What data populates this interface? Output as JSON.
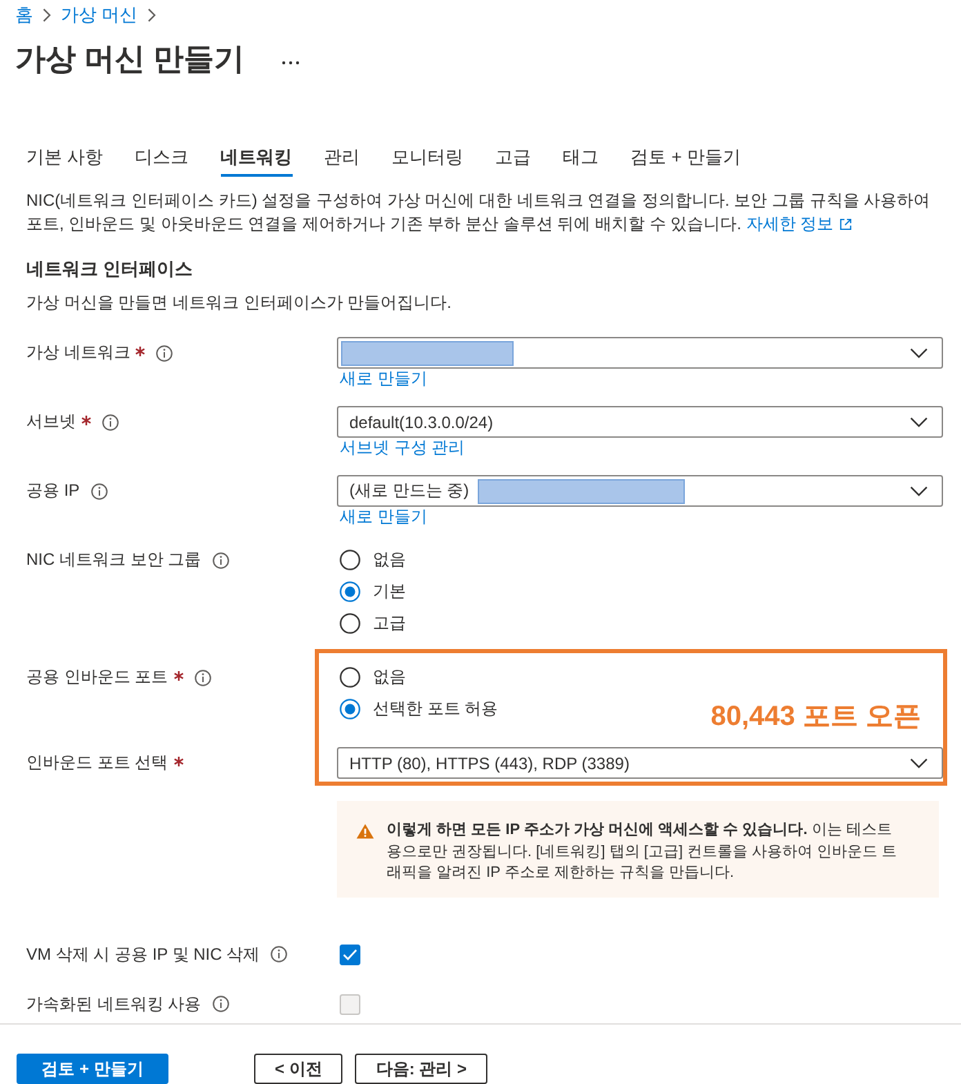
{
  "breadcrumb": [
    {
      "label": "홈"
    },
    {
      "label": "가상 머신"
    }
  ],
  "header": {
    "title": "가상 머신 만들기"
  },
  "tabs": [
    {
      "label": "기본 사항",
      "selected": false
    },
    {
      "label": "디스크",
      "selected": false
    },
    {
      "label": "네트워킹",
      "selected": true
    },
    {
      "label": "관리",
      "selected": false
    },
    {
      "label": "모니터링",
      "selected": false
    },
    {
      "label": "고급",
      "selected": false
    },
    {
      "label": "태그",
      "selected": false
    },
    {
      "label": "검토 + 만들기",
      "selected": false
    }
  ],
  "intro": {
    "text": "NIC(네트워크 인터페이스 카드) 설정을 구성하여 가상 머신에 대한 네트워크 연결을 정의합니다. 보안 그룹 규칙을 사용하여 포트, 인바운드 및 아웃바운드 연결을 제어하거나 기존 부하 분산 솔루션 뒤에 배치할 수 있습니다.",
    "link": "자세한 정보"
  },
  "section": {
    "title": "네트워크 인터페이스",
    "subtitle": "가상 머신을 만들면 네트워크 인터페이스가 만들어집니다."
  },
  "fields": [
    {
      "kind": "select",
      "label": "가상 네트워크",
      "required": true,
      "info": true,
      "redacted": true,
      "link": "새로 만들기",
      "highlighted": false
    },
    {
      "kind": "select",
      "label": "서브넷",
      "required": true,
      "info": true,
      "value": "default(10.3.0.0/24)",
      "redacted": false,
      "link": "서브넷 구성 관리",
      "highlighted": false
    },
    {
      "kind": "select",
      "label": "공용 IP",
      "required": false,
      "info": true,
      "value": "(새로 만드는 중)",
      "redacted": true,
      "link": "새로 만들기",
      "highlighted": false
    },
    {
      "kind": "radio",
      "label": "NIC 네트워크 보안 그룹",
      "required": false,
      "info": true,
      "options": [
        {
          "label": "없음",
          "selected": false
        },
        {
          "label": "기본",
          "selected": true
        },
        {
          "label": "고급",
          "selected": false
        }
      ],
      "highlighted": false
    },
    {
      "kind": "radio",
      "label": "공용 인바운드 포트",
      "required": true,
      "info": true,
      "options": [
        {
          "label": "없음",
          "selected": false
        },
        {
          "label": "선택한 포트 허용",
          "selected": true
        }
      ],
      "highlighted": true
    },
    {
      "kind": "select",
      "label": "인바운드 포트 선택",
      "required": true,
      "info": false,
      "value": "HTTP (80), HTTPS (443), RDP (3389)",
      "redacted": false,
      "highlighted": true
    },
    {
      "kind": "warning",
      "text": "**이렇게 하면 모든 IP 주소가 가상 머신에 액세스할 수 있습니다.** 이는 테스트용으로만 권장됩니다. [네트워킹] 탭의 [고급] 컨트롤을 사용하여 인바운드 트래픽을 알려진 IP 주소로 제한하는 규칙을 만듭니다.",
      "highlighted": false
    },
    {
      "kind": "checkbox",
      "label": "VM 삭제 시 공용 IP 및 NIC 삭제",
      "required": false,
      "info": true,
      "checked": true,
      "disabled": false,
      "highlighted": false
    },
    {
      "kind": "checkbox",
      "label": "가속화된 네트워킹 사용",
      "required": false,
      "info": true,
      "checked": false,
      "disabled": true,
      "highlighted": false
    }
  ],
  "annotation": {
    "text": "80,443 포트 오픈"
  },
  "footer": {
    "buttons": [
      {
        "label": "검토 + 만들기",
        "kind": "primary"
      },
      {
        "label": "< 이전",
        "kind": "secondary"
      },
      {
        "label": "다음: 관리 >",
        "kind": "secondary"
      }
    ]
  }
}
